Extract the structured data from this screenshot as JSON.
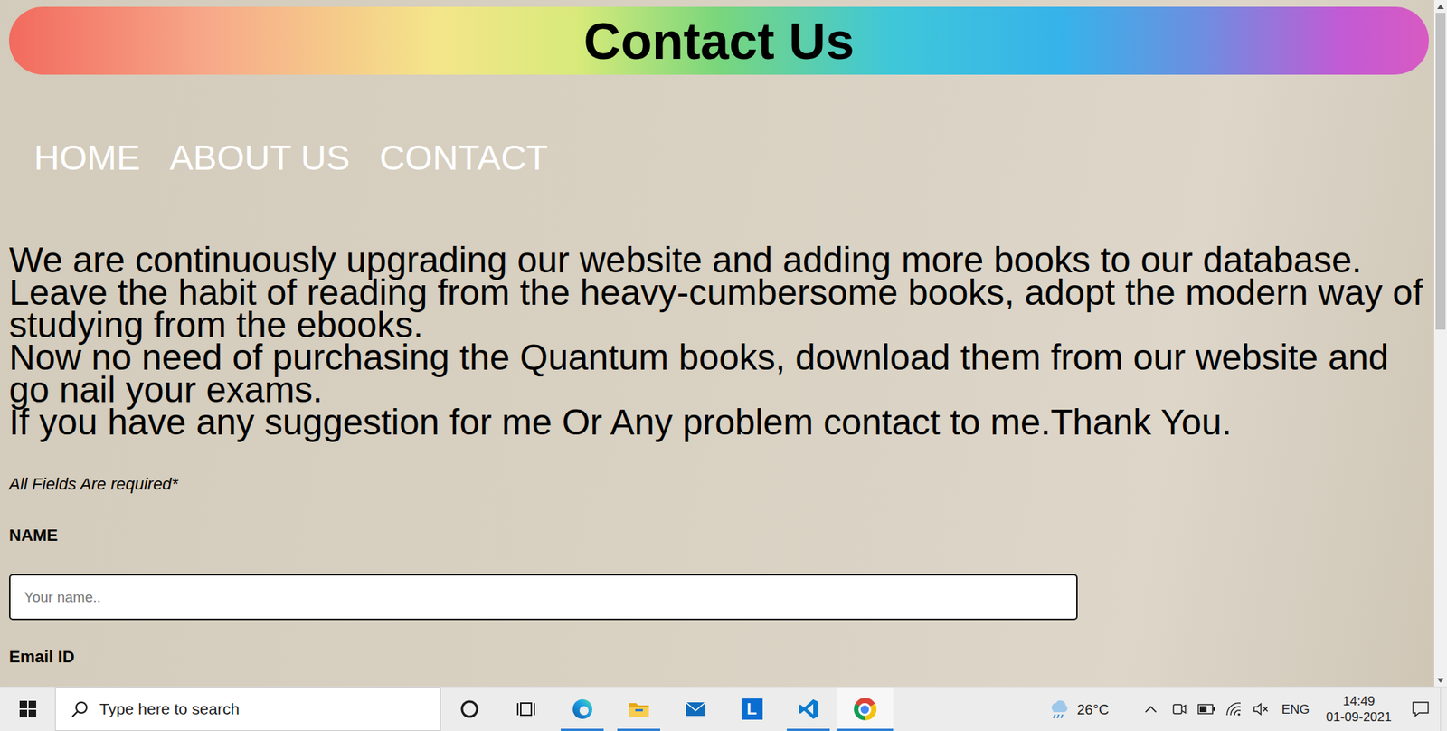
{
  "page": {
    "title": "Contact Us",
    "nav": [
      {
        "label": "HOME"
      },
      {
        "label": "ABOUT US"
      },
      {
        "label": "CONTACT"
      }
    ],
    "paragraphs": [
      "We are continuously upgrading our website and adding more books to our database.",
      "Leave the habit of reading from the heavy-cumbersome books, adopt the modern way of studying from the ebooks.",
      "Now no need of purchasing the Quantum books, download them from our website and go nail your exams.",
      "If you have any suggestion for me Or Any problem contact to me.Thank You."
    ],
    "form": {
      "note": "All Fields Are required*",
      "fields": [
        {
          "label": "NAME",
          "placeholder": "Your name.."
        },
        {
          "label": "Email ID"
        }
      ]
    },
    "scrollbar": {
      "level": 0.48
    }
  },
  "taskbar": {
    "search": {
      "placeholder": "Type here to search"
    },
    "apps": [
      {
        "kind": "cortana",
        "running": false,
        "selected": false
      },
      {
        "kind": "task-view",
        "running": false,
        "selected": false
      },
      {
        "kind": "edge",
        "running": true,
        "selected": false
      },
      {
        "kind": "explorer",
        "running": true,
        "selected": false
      },
      {
        "kind": "mail",
        "running": false,
        "selected": false
      },
      {
        "kind": "letter",
        "label": "L",
        "running": false,
        "selected": false
      },
      {
        "kind": "vscode",
        "running": true,
        "selected": false
      },
      {
        "kind": "chrome",
        "running": true,
        "selected": true
      }
    ],
    "weather": "26°C",
    "language": "ENG",
    "time": "14:49",
    "date": "01-09-2021"
  }
}
